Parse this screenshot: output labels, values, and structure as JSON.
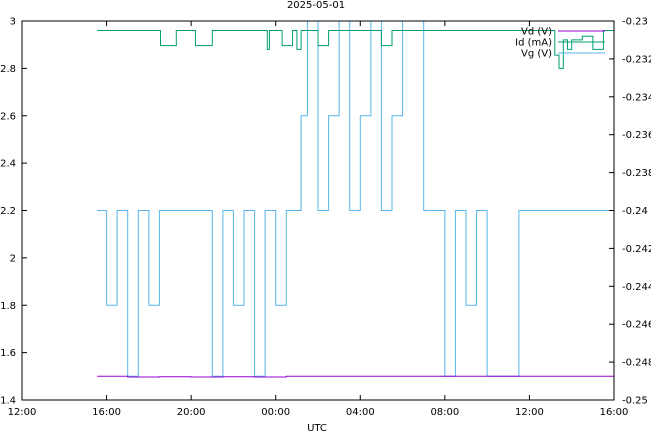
{
  "chart_data": {
    "type": "line",
    "title": "2025-05-01",
    "xlabel": "UTC",
    "ylabel": "",
    "y2label": "",
    "x_ticks": [
      "12:00",
      "16:00",
      "20:00",
      "00:00",
      "04:00",
      "08:00",
      "12:00",
      "16:00"
    ],
    "x_tick_hours": [
      0,
      4,
      8,
      12,
      16,
      20,
      24,
      28
    ],
    "xlim_hours": [
      0,
      28
    ],
    "ylim": [
      1.4,
      3.0
    ],
    "y_ticks": [
      1.4,
      1.6,
      1.8,
      2.0,
      2.2,
      2.4,
      2.6,
      2.8,
      3.0
    ],
    "y_tick_labels": [
      "1.4",
      "1.6",
      "1.8",
      "2",
      "2.2",
      "2.4",
      "2.6",
      "2.8",
      "3"
    ],
    "y2lim": [
      -0.25,
      -0.23
    ],
    "y2_ticks": [
      -0.25,
      -0.248,
      -0.246,
      -0.244,
      -0.242,
      -0.24,
      -0.238,
      -0.236,
      -0.234,
      -0.232,
      -0.23
    ],
    "y2_tick_labels": [
      "-0.25",
      "-0.248",
      "-0.246",
      "-0.244",
      "-0.242",
      "-0.24",
      "-0.238",
      "-0.236",
      "-0.234",
      "-0.232",
      "-0.23"
    ],
    "legend_position": "top-right",
    "series": [
      {
        "name": "Vd (V)",
        "axis": "left",
        "color": "#9400d3",
        "x": [
          3.55,
          5.0,
          6.5,
          8.0,
          9.5,
          11.0,
          12.5,
          14.0,
          16.0,
          18.0,
          20.0,
          22.0,
          24.0,
          26.0,
          28.0
        ],
        "y": [
          1.5,
          1.497,
          1.498,
          1.497,
          1.498,
          1.497,
          1.5,
          1.5,
          1.5,
          1.5,
          1.5,
          1.5,
          1.5,
          1.5,
          1.5
        ]
      },
      {
        "name": "Id (mA)",
        "axis": "right",
        "color": "#009e73",
        "x": [
          3.55,
          6.5,
          6.55,
          7.2,
          7.3,
          8.0,
          8.2,
          9.0,
          10.0,
          11.5,
          11.6,
          11.7,
          12.0,
          12.3,
          12.8,
          13.0,
          13.2,
          13.5,
          14.0,
          14.5,
          15.0,
          15.8,
          16.5,
          17.0,
          17.5,
          18.0,
          20.0,
          22.0,
          25.0,
          25.2,
          25.4,
          25.6,
          25.8,
          26.0,
          26.5,
          27.0,
          27.5,
          28.0
        ],
        "y": [
          -0.2305,
          -0.2305,
          -0.2313,
          -0.2313,
          -0.2305,
          -0.2305,
          -0.2313,
          -0.2305,
          -0.2305,
          -0.2305,
          -0.2315,
          -0.2305,
          -0.2305,
          -0.2313,
          -0.2305,
          -0.2315,
          -0.2305,
          -0.2305,
          -0.2313,
          -0.2305,
          -0.2305,
          -0.2305,
          -0.2305,
          -0.2313,
          -0.2305,
          -0.2305,
          -0.2305,
          -0.2305,
          -0.2305,
          -0.2318,
          -0.2325,
          -0.231,
          -0.2315,
          -0.231,
          -0.2308,
          -0.2315,
          -0.2305,
          -0.231
        ]
      },
      {
        "name": "Vg (V)",
        "axis": "left",
        "color": "#56b4e9",
        "x": [
          3.55,
          4.0,
          4.5,
          5.0,
          5.5,
          6.0,
          6.5,
          7.0,
          8.5,
          9.0,
          9.5,
          10.0,
          10.5,
          11.0,
          11.5,
          12.0,
          12.5,
          13.0,
          13.2,
          13.5,
          14.0,
          14.5,
          15.0,
          15.5,
          16.0,
          16.5,
          17.0,
          17.5,
          18.0,
          19.0,
          19.5,
          20.0,
          20.5,
          21.0,
          21.5,
          22.0,
          23.5,
          24.0,
          25.0,
          26.0,
          27.0,
          28.0
        ],
        "y": [
          2.2,
          1.8,
          2.2,
          1.5,
          2.2,
          1.8,
          2.2,
          2.2,
          2.2,
          1.5,
          2.2,
          1.8,
          2.2,
          1.5,
          2.2,
          1.8,
          2.2,
          2.2,
          2.6,
          3.0,
          2.2,
          2.6,
          3.0,
          2.2,
          2.6,
          3.0,
          2.2,
          2.6,
          3.0,
          2.2,
          2.2,
          1.5,
          2.2,
          1.8,
          2.2,
          1.5,
          2.2,
          2.2,
          2.2,
          2.2,
          2.2,
          2.2
        ]
      }
    ]
  }
}
